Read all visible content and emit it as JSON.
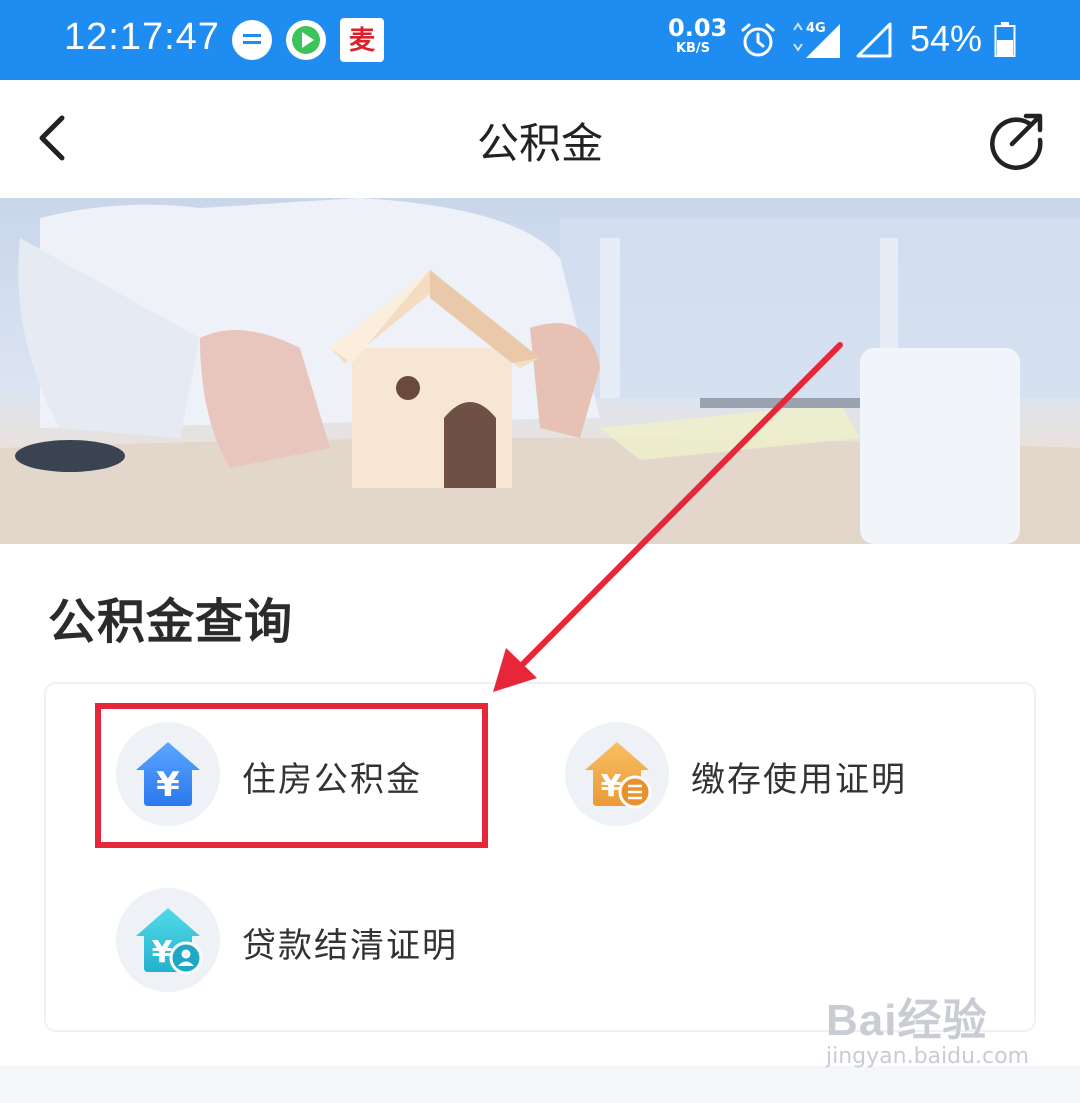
{
  "status_bar": {
    "time": "12:17:47",
    "net_speed_value": "0.03",
    "net_speed_unit": "KB/S",
    "network_type": "4G",
    "battery_percent": "54%",
    "app_icons": [
      "message-icon",
      "video-player-icon",
      "mai-app-icon"
    ],
    "app3_glyph": "麦"
  },
  "header": {
    "title": "公积金",
    "back_icon": "chevron-left-icon",
    "share_icon": "share-icon"
  },
  "banner": {
    "image": "hands-holding-wooden-house-photo"
  },
  "section": {
    "title": "公积金查询",
    "items": [
      {
        "label": "住房公积金",
        "icon": "house-yen-icon",
        "color": "#2f86f0"
      },
      {
        "label": "缴存使用证明",
        "icon": "house-yen-document-icon",
        "color": "#f0a03c"
      },
      {
        "label": "贷款结清证明",
        "icon": "house-yen-person-icon",
        "color": "#2bc2d6"
      }
    ]
  },
  "annotation": {
    "highlight_color": "#e8263a",
    "arrow_color": "#e8263a"
  },
  "watermark": {
    "logo": "Bai经验",
    "url": "jingyan.baidu.com"
  }
}
